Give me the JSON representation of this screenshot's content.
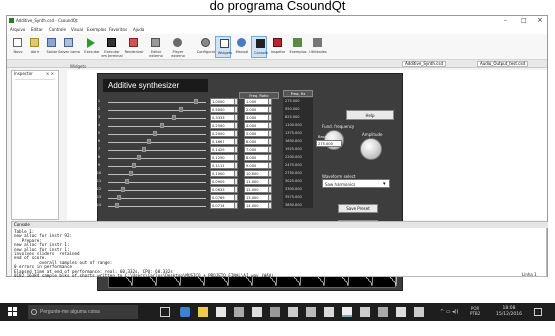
{
  "caption": "do programa CsoundQt",
  "window": {
    "title": "Additive_Synth.csd - CsoundQt",
    "controls": [
      "–",
      "□",
      "×"
    ],
    "menu": [
      "Arquivo",
      "Editar",
      "Controle",
      "Visual",
      "Exemplos",
      "Favoritos",
      "Ajuda"
    ],
    "toolbar": [
      "Novo",
      "Abrir",
      "Salvar",
      "Salvar como",
      "Executar",
      "Executar em terminal",
      "Renderizar",
      "Editor externo",
      "Player externo",
      "Configurar",
      "Widgets",
      "Manual",
      "Console",
      "Inspetor",
      "Exemplos",
      "Utilidades"
    ],
    "tabs": [
      "Additive_Synth.csd",
      "Audio_Output_test.csd"
    ],
    "left_pane_title": "Inspector",
    "left_pane_close": "× ×",
    "widgets_panel_title": "Widgets"
  },
  "synth": {
    "title": "Additive synthesizer",
    "headers": {
      "amp": "Freq. Ratio",
      "freq": "Freq. Hz"
    },
    "rows": [
      {
        "n": "1",
        "amp": "1.0000",
        "ratio": "1.000",
        "hz": "275.000",
        "level": 0.92
      },
      {
        "n": "2",
        "amp": "0.5000",
        "ratio": "2.000",
        "hz": "550.000",
        "level": 0.75
      },
      {
        "n": "3",
        "amp": "0.3333",
        "ratio": "3.000",
        "hz": "825.000",
        "level": 0.68
      },
      {
        "n": "4",
        "amp": "0.2500",
        "ratio": "4.000",
        "hz": "1100.000",
        "level": 0.55
      },
      {
        "n": "5",
        "amp": "0.2000",
        "ratio": "5.000",
        "hz": "1375.000",
        "level": 0.48
      },
      {
        "n": "6",
        "amp": "0.1667",
        "ratio": "6.000",
        "hz": "1650.000",
        "level": 0.42
      },
      {
        "n": "7",
        "amp": "0.1429",
        "ratio": "7.000",
        "hz": "1925.000",
        "level": 0.36
      },
      {
        "n": "8",
        "amp": "0.1250",
        "ratio": "8.000",
        "hz": "2200.000",
        "level": 0.31
      },
      {
        "n": "9",
        "amp": "0.1111",
        "ratio": "9.000",
        "hz": "2475.000",
        "level": 0.26
      },
      {
        "n": "10",
        "amp": "0.1000",
        "ratio": "10.000",
        "hz": "2750.000",
        "level": 0.22
      },
      {
        "n": "11",
        "amp": "0.0909",
        "ratio": "11.000",
        "hz": "3025.000",
        "level": 0.18
      },
      {
        "n": "12",
        "amp": "0.0833",
        "ratio": "12.000",
        "hz": "3300.000",
        "level": 0.14
      },
      {
        "n": "13",
        "amp": "0.0769",
        "ratio": "13.000",
        "hz": "3575.000",
        "level": 0.1
      },
      {
        "n": "14",
        "amp": "0.0714",
        "ratio": "14.000",
        "hz": "3850.000",
        "level": 0.07
      }
    ],
    "help_button": "Help",
    "base_label": "Base freq.",
    "base_value": "275.000",
    "knob_label_1": "Fund. frequency",
    "knob_label_2": "Amplitude",
    "waveform_label": "Waveform select",
    "waveform_value": "Saw harmonics",
    "preset_button": "Save Preset",
    "reset_button": "Reset",
    "scope_label": "Oscilloscope output"
  },
  "console": {
    "title": "Console",
    "lines": [
      "Table 1:",
      "new alloc for instr 92:",
      "   Prepare:",
      "new alloc for instr 1:",
      "new alloc for instr 1:",
      "involves sliders  retained",
      "end of score.",
      "          overall samples out of range:",
      "0 errors in performance",
      "Elapsed time at end of performance: real: 60.332s, CPU: 60.332s",
      "0182 16384 sample blks of shorts written to C:\\Users\\Carlos\\Desktop\\MUSICO + PROJETO FINAL\\AI.wav (WAV)"
    ],
    "line_status": "Linha 1"
  },
  "taskbar": {
    "search_placeholder": "Pergunte-me alguma coisa",
    "lang": "POR\nPTB2",
    "time": "18:08",
    "date": "15/12/2016"
  },
  "colors": {
    "panel_bg": "#3d3d3d",
    "title_bg": "#1a1a1a",
    "scope_bg": "#000000",
    "taskbar_bg": "#1e1e1e"
  }
}
